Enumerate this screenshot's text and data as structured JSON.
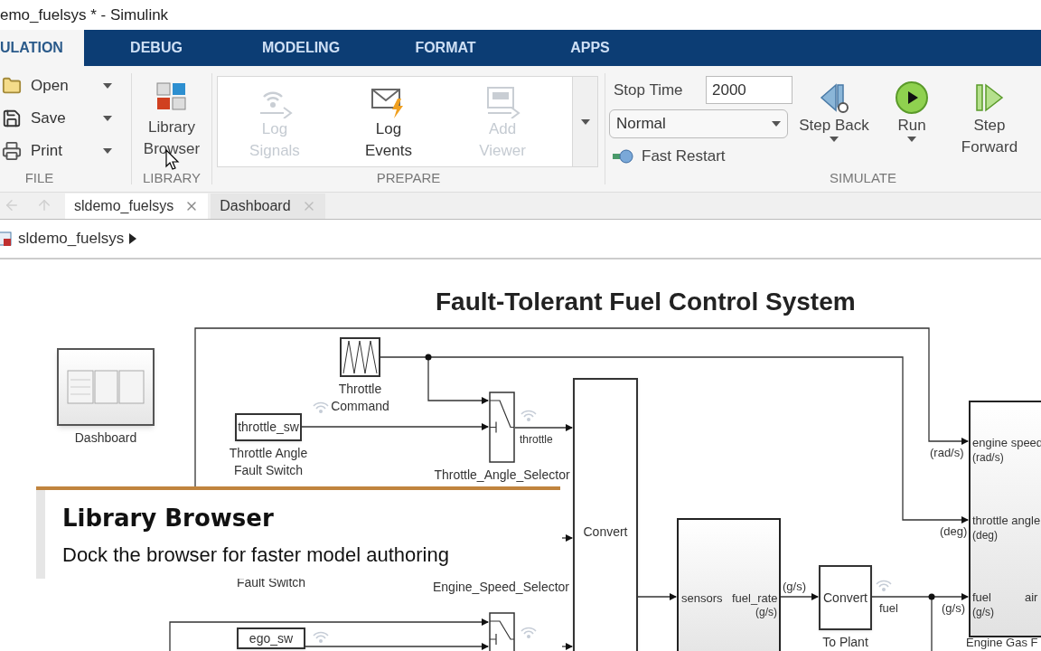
{
  "window": {
    "title": "emo_fuelsys * - Simulink"
  },
  "ribbon_tabs": [
    {
      "label": "ULATION",
      "selected": true
    },
    {
      "label": "DEBUG",
      "selected": false
    },
    {
      "label": "MODELING",
      "selected": false
    },
    {
      "label": "FORMAT",
      "selected": false
    },
    {
      "label": "APPS",
      "selected": false
    }
  ],
  "file_section": {
    "label": "FILE",
    "items": [
      {
        "label": "Open",
        "kind": "open"
      },
      {
        "label": "Save",
        "kind": "save"
      },
      {
        "label": "Print",
        "kind": "print"
      }
    ]
  },
  "library_section": {
    "label": "LIBRARY",
    "button": "Library Browser"
  },
  "prepare_section": {
    "label": "PREPARE",
    "items": [
      {
        "label": "Log Signals",
        "kind": "signals",
        "disabled": true
      },
      {
        "label": "Log Events",
        "kind": "events",
        "disabled": false
      },
      {
        "label": "Add Viewer",
        "kind": "viewer",
        "disabled": true
      }
    ]
  },
  "simulate_section": {
    "label": "SIMULATE",
    "stop_time_label": "Stop Time",
    "stop_time": "2000",
    "mode": "Normal",
    "fast_restart": "Fast Restart",
    "buttons": [
      {
        "label": "Step Back",
        "kind": "step_back",
        "dropdown": true
      },
      {
        "label": "Run",
        "kind": "run",
        "dropdown": true
      },
      {
        "label": "Step Forward",
        "kind": "step_forward",
        "dropdown": false
      }
    ]
  },
  "editor_tabs": [
    {
      "label": "sldemo_fuelsys",
      "selected": true
    },
    {
      "label": "Dashboard",
      "selected": false
    }
  ],
  "breadcrumb": [
    "sldemo_fuelsys"
  ],
  "diagram": {
    "title": "Fault-Tolerant Fuel Control System",
    "blocks": [
      {
        "kind": "wave",
        "label": "Throttle Command"
      },
      {
        "kind": "dashboard",
        "label": "Dashboard"
      },
      {
        "kind": "constant",
        "text": "throttle_sw",
        "label": "Throttle Angle Fault Switch"
      },
      {
        "kind": "switch",
        "label": "Throttle_Angle_Selector"
      },
      {
        "kind": "convert",
        "text": "Convert"
      },
      {
        "kind": "constant",
        "text": "ego_sw"
      },
      {
        "kind": "convert",
        "text": "Convert",
        "label": "To Plant"
      },
      {
        "kind": "subsystem"
      },
      {
        "kind": "subsystem"
      },
      {
        "kind": "switch"
      }
    ],
    "texts": [
      "throttle",
      "Fault Switch",
      "Engine_Speed_Selector",
      "sensors",
      "fuel_rate",
      "(g/s)",
      "(g/s)",
      "fuel",
      "(g/s)",
      "(rad/s)",
      "engine speed",
      "(rad/s)",
      "(deg)",
      "throttle angle",
      "(deg)",
      "fuel",
      "(g/s)",
      "air",
      "Engine Gas F"
    ]
  },
  "caption": {
    "title": "Library Browser",
    "text": "Dock the browser for faster model authoring"
  }
}
